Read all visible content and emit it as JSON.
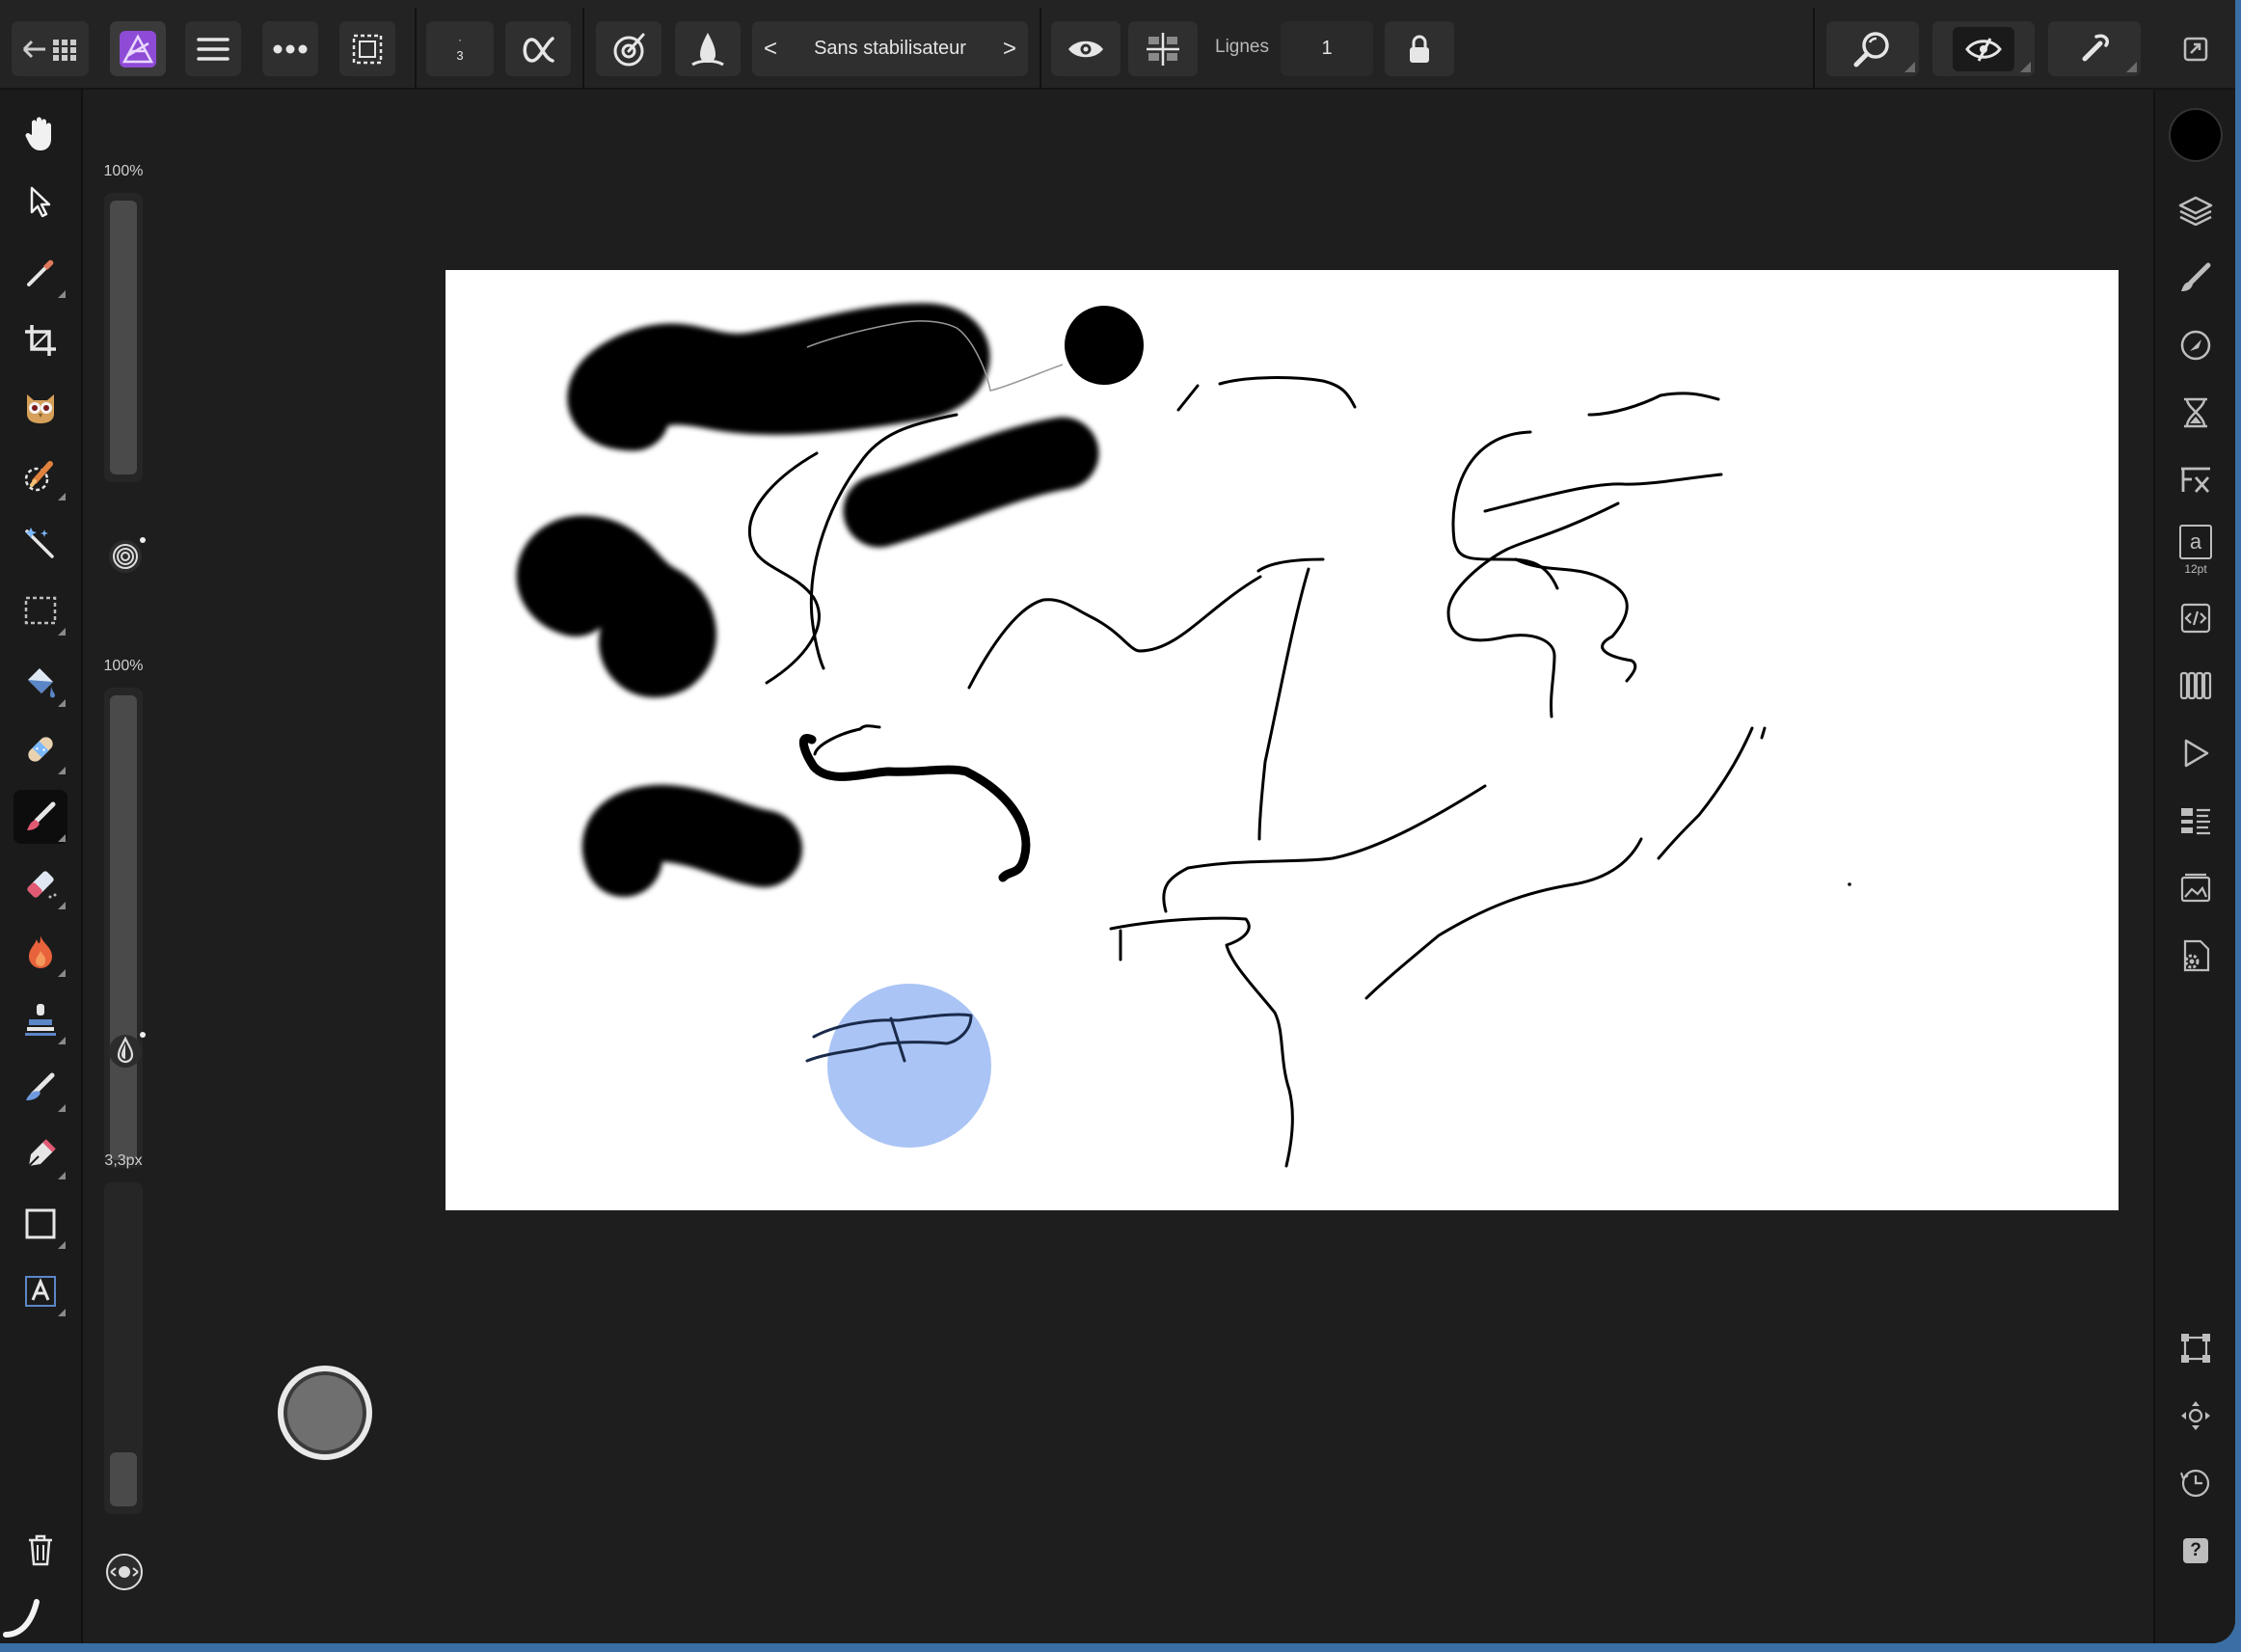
{
  "toolbar": {
    "brush_size_hint": "3",
    "stabilizer_label": "Sans stabilisateur",
    "prev_arrow": "<",
    "next_arrow": ">",
    "lines_label": "Lignes",
    "lines_value": "1"
  },
  "left_tools": [
    "hand-icon",
    "move-arrow-icon",
    "color-picker-icon",
    "crop-icon",
    "red-eye-owl-icon",
    "selection-brush-icon",
    "magic-wand-icon",
    "marquee-icon",
    "flood-fill-icon",
    "healing-icon",
    "paint-brush-icon",
    "eraser-icon",
    "burn-icon",
    "clone-stamp-icon",
    "smudge-icon",
    "pen-icon",
    "rectangle-icon",
    "text-icon"
  ],
  "sliders": {
    "opacity_label": "100%",
    "opacity_level": 1.0,
    "flow_label": "100%",
    "flow_level": 1.0,
    "width_label": "3,3px",
    "width_level": 0.02
  },
  "right_panel": {
    "color": "#000000",
    "text_style_letter": "a",
    "text_style_size": "12pt",
    "help_symbol": "?"
  },
  "colors": {
    "app_bg": "#1e1e1e",
    "toolbar_bg": "#232323",
    "button_bg": "#2f2f2f",
    "accent_purple": "#8e4bd6",
    "ink": "#000000",
    "blue_circle": "#aac4f5"
  }
}
